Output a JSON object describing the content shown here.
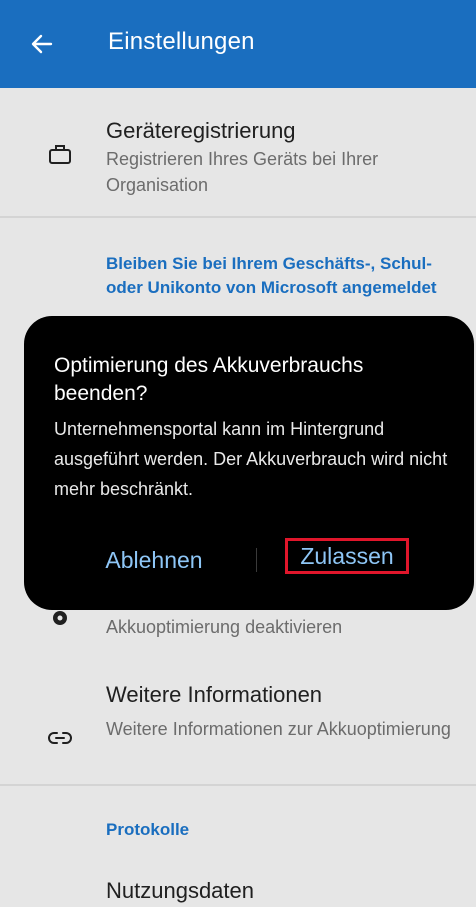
{
  "appbar": {
    "title": "Einstellungen",
    "back_icon": "arrow-left-icon",
    "color": "#1a6ebf"
  },
  "device_registration": {
    "title": "Geräteregistrierung",
    "subtitle": "Registrieren Ihres Geräts bei Ihrer Organisation",
    "icon": "briefcase-icon"
  },
  "stay_signed_in": {
    "header": "Bleiben Sie bei Ihrem Geschäfts-, Schul- oder Unikonto von Microsoft angemeldet"
  },
  "battery_item": {
    "subtitle": "Akkuoptimierung deaktivieren",
    "icon": "gear-icon"
  },
  "more_info": {
    "title": "Weitere Informationen",
    "subtitle": "Weitere Informationen zur Akkuoptimierung",
    "icon": "link-icon"
  },
  "logs": {
    "header": "Protokolle",
    "usage_title": "Nutzungsdaten"
  },
  "dialog": {
    "title": "Optimierung des Akkuverbrauchs beenden?",
    "body": "Unternehmensportal kann im Hintergrund ausgeführt werden. Der Akkuverbrauch wird nicht mehr beschränkt.",
    "deny_label": "Ablehnen",
    "allow_label": "Zulassen",
    "button_color": "#8ec6f6",
    "highlight_color": "#e0162b"
  }
}
